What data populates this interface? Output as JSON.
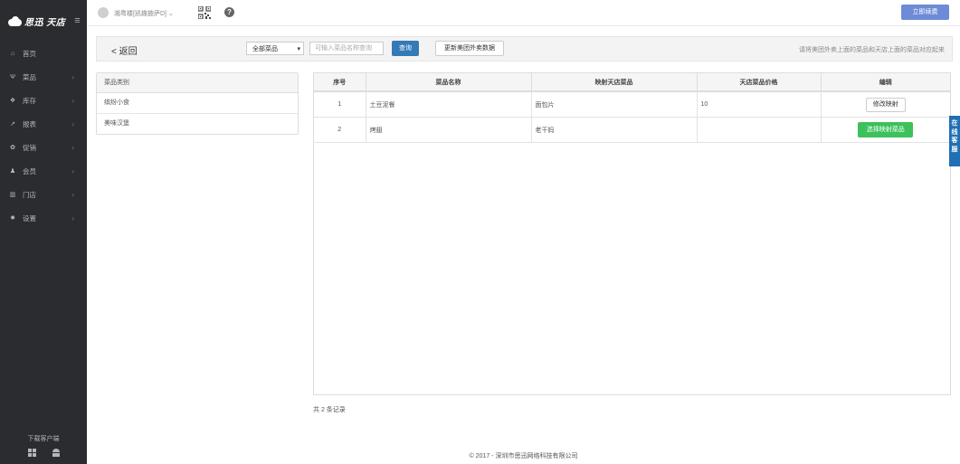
{
  "sidebar": {
    "logo_text": "思迅 天店",
    "items": [
      {
        "label": "首页",
        "icon": "home-icon",
        "glyph": "⌂",
        "has_sub": false
      },
      {
        "label": "菜品",
        "icon": "cutlery-icon",
        "glyph": "Ψ",
        "has_sub": true
      },
      {
        "label": "库存",
        "icon": "cubes-icon",
        "glyph": "❖",
        "has_sub": true
      },
      {
        "label": "报表",
        "icon": "line-chart-icon",
        "glyph": "↗",
        "has_sub": true
      },
      {
        "label": "促销",
        "icon": "gift-icon",
        "glyph": "✿",
        "has_sub": true
      },
      {
        "label": "会员",
        "icon": "users-icon",
        "glyph": "♟",
        "has_sub": true
      },
      {
        "label": "门店",
        "icon": "bank-icon",
        "glyph": "▥",
        "has_sub": true
      },
      {
        "label": "设置",
        "icon": "gear-icon",
        "glyph": "✹",
        "has_sub": true
      }
    ],
    "download_label": "下载客户端"
  },
  "topbar": {
    "user_name": "湘粤楼[凯趣披萨D] ",
    "user_chevron": "⌄",
    "renew_label": "立即续费",
    "help_glyph": "?"
  },
  "filter": {
    "back_label": "< 返回",
    "select_value": "全部菜品",
    "search_placeholder": "可输入菜品名称查询",
    "query_label": "查询",
    "update_label": "更新美团外卖数据",
    "hint": "请将美团外卖上面的菜品和天店上面的菜品对应起来"
  },
  "categories": {
    "header": "菜品类别",
    "items": [
      "缤纷小食",
      "美味汉堡"
    ]
  },
  "table": {
    "headers": [
      "序号",
      "菜品名称",
      "映射天店菜品",
      "天店菜品价格",
      "编辑"
    ],
    "rows": [
      {
        "index": "1",
        "name": "土豆泥餐",
        "mapped": "面包片",
        "price": "10",
        "action": "修改映射",
        "action_type": "modify"
      },
      {
        "index": "2",
        "name": "烤翅",
        "mapped": "老干妈",
        "price": "",
        "action": "选择映射菜品",
        "action_type": "select"
      }
    ]
  },
  "record_count": "共 2 条记录",
  "footer": "© 2017 - 深圳市思迅网络科技有限公司",
  "cs_widget": "在线客服",
  "colors": {
    "sidebar_bg": "#2a2c2f",
    "primary": "#337ab7",
    "renew": "#6d8bd6",
    "success": "#3cc15c",
    "widget": "#1f6fb5"
  }
}
